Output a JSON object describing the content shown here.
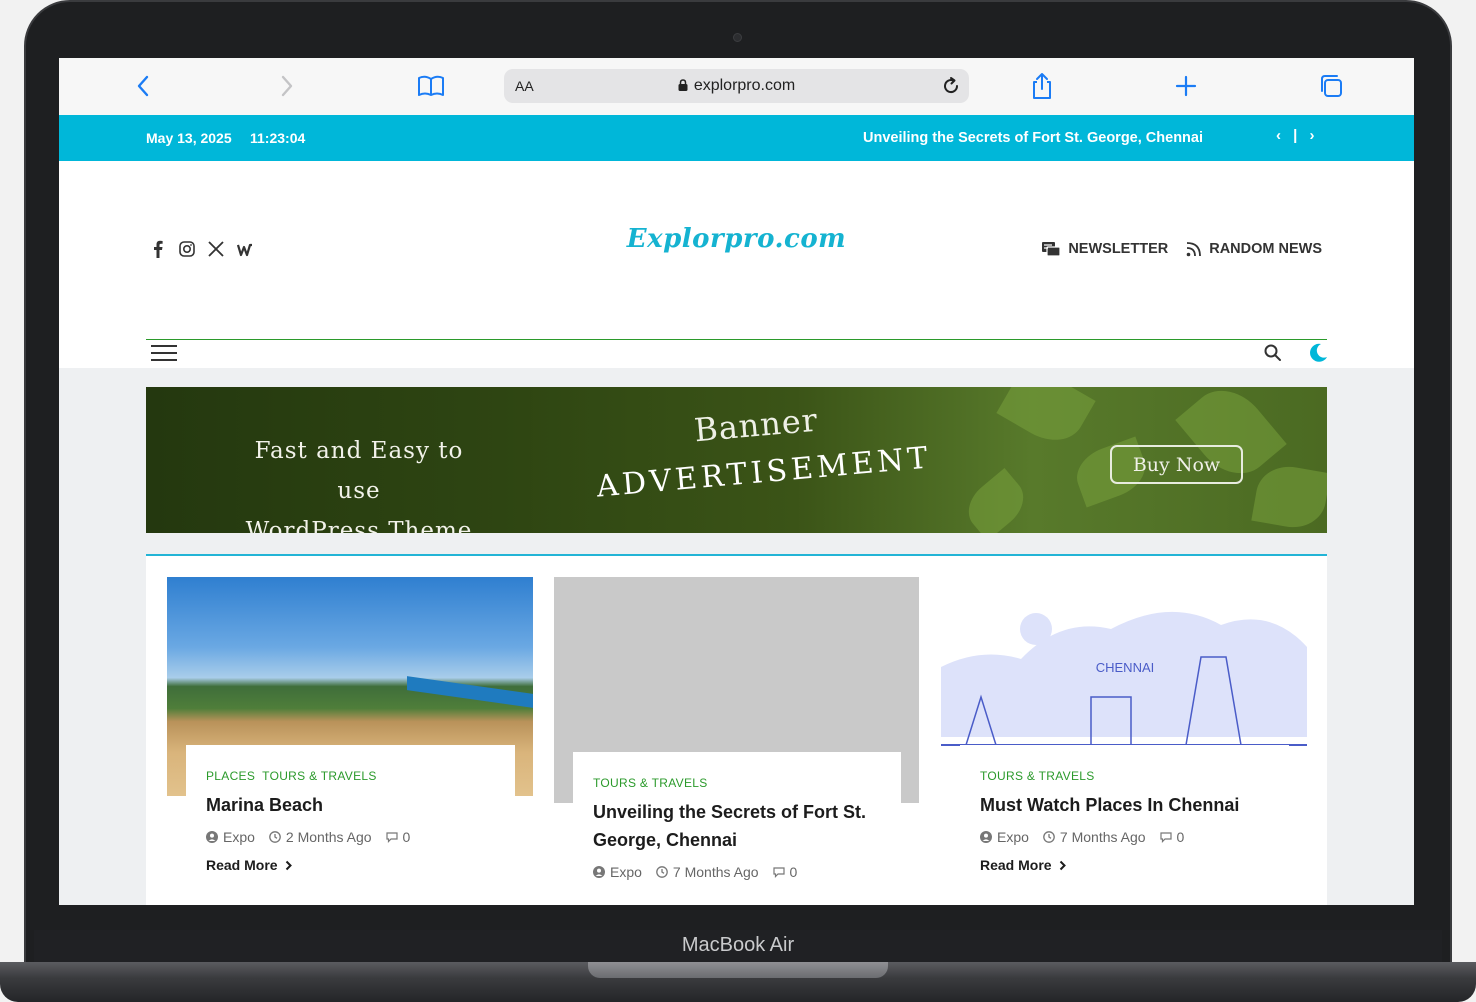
{
  "device": {
    "label": "MacBook Air"
  },
  "browser": {
    "url": "explorpro.com",
    "reader_label": "AA"
  },
  "topbar": {
    "date": "May 13, 2025",
    "time": "11:23:04",
    "ticker": "Unveiling the Secrets of Fort St. George, Chennai",
    "prev": "‹",
    "sep": "|",
    "next": "›"
  },
  "header": {
    "social_icons": [
      "facebook-icon",
      "instagram-icon",
      "x-icon",
      "threads-icon"
    ],
    "logo": "Explorpro.com",
    "newsletter": "NEWSLETTER",
    "random_news": "RANDOM NEWS"
  },
  "banner": {
    "line1": "Fast and Easy to use",
    "line2": "WordPress Theme",
    "word1": "Banner",
    "word2": "ADVERTISEMENT",
    "button": "Buy Now"
  },
  "posts": [
    {
      "categories": [
        "PLACES",
        "TOURS & TRAVELS"
      ],
      "title": "Marina Beach",
      "author": "Expo",
      "date": "2 Months Ago",
      "comments": "0",
      "read_more": "Read More"
    },
    {
      "categories": [
        "TOURS & TRAVELS"
      ],
      "title": "Unveiling the Secrets of Fort St. George, Chennai",
      "author": "Expo",
      "date": "7 Months Ago",
      "comments": "0"
    },
    {
      "categories": [
        "TOURS & TRAVELS"
      ],
      "title": "Must Watch Places In Chennai",
      "author": "Expo",
      "date": "7 Months Ago",
      "comments": "0",
      "read_more": "Read More",
      "image_text": "CHENNAI"
    }
  ],
  "colors": {
    "accent": "#00b7d9",
    "category": "#2b9a2b",
    "browser_blue": "#1b7cf5"
  }
}
